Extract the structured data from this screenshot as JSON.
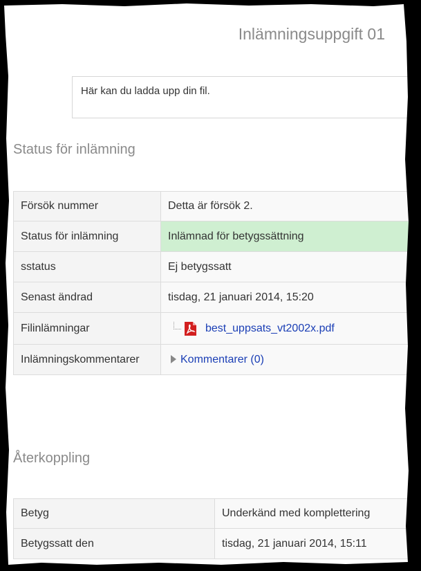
{
  "title": "Inlämningsuppgift 01",
  "intro": "Här kan du ladda upp din fil.",
  "status_section": {
    "heading": "Status för inlämning",
    "rows": [
      {
        "label": "Försök nummer",
        "value": "Detta är försök 2."
      },
      {
        "label": "Status för inlämning",
        "value": "Inlämnad för betygssättning"
      },
      {
        "label": "sstatus",
        "value": "Ej betygssatt"
      },
      {
        "label": "Senast ändrad",
        "value": "tisdag, 21 januari 2014, 15:20"
      },
      {
        "label": "Filinlämningar",
        "file_name": "best_uppsats_vt2002x.pdf",
        "icon": "pdf-icon"
      },
      {
        "label": "Inlämningskommentarer",
        "comments_link": "Kommentarer (0)",
        "icon": "triangle-right-icon"
      }
    ],
    "status_color": "#cfefd1"
  },
  "feedback_section": {
    "heading": "Återkoppling",
    "rows": [
      {
        "label": "Betyg",
        "value": "Underkänd med komplettering"
      },
      {
        "label": "Betygssatt den",
        "value": "tisdag, 21 januari 2014, 15:11"
      }
    ]
  },
  "colors": {
    "link": "#1a3eb5",
    "heading": "#8a8a8a",
    "frame": "#000000"
  }
}
